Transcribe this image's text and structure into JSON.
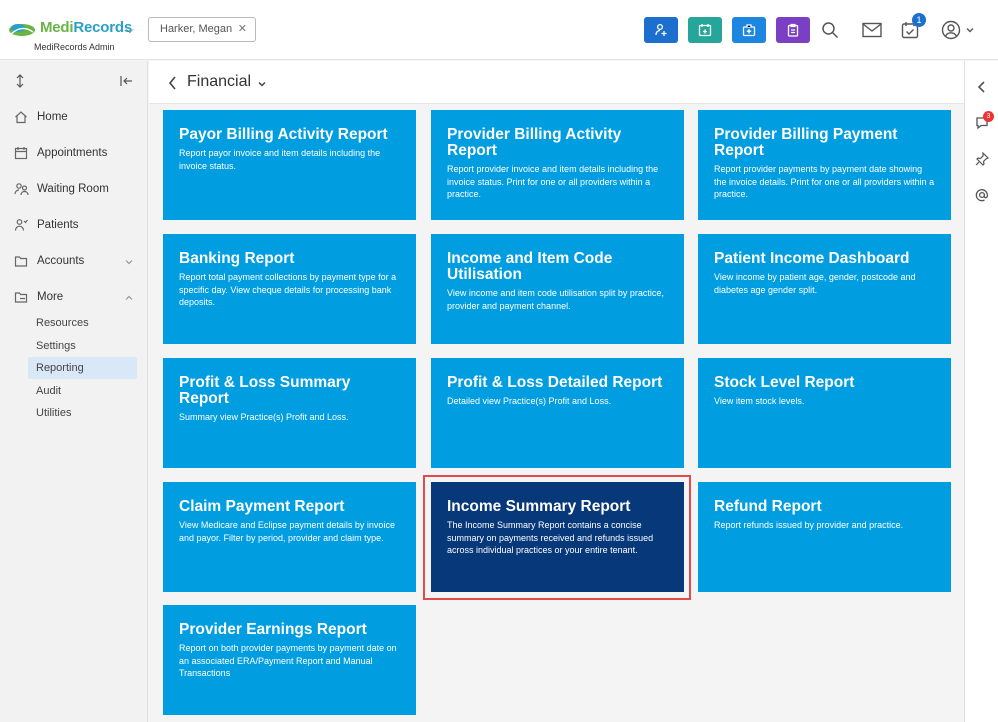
{
  "app": {
    "brand_part1": "Medi",
    "brand_part2": "Records",
    "subtitle": "MediRecords Admin",
    "accent": "#009ee0",
    "selected_card_color": "#07387a"
  },
  "header": {
    "patient_name": "Harker, Megan",
    "task_badge_count": "1",
    "action_buttons": [
      {
        "icon": "add-user-icon",
        "color": "#1d6fcf"
      },
      {
        "icon": "calendar-add-icon",
        "color": "#26a69a"
      },
      {
        "icon": "medical-case-icon",
        "color": "#1d86e0"
      },
      {
        "icon": "clipboard-icon",
        "color": "#7b3fc4"
      }
    ]
  },
  "sidebar": {
    "items": [
      {
        "label": "Home",
        "icon": "home-icon"
      },
      {
        "label": "Appointments",
        "icon": "calendar-icon"
      },
      {
        "label": "Waiting Room",
        "icon": "people-icon"
      },
      {
        "label": "Patients",
        "icon": "patient-icon"
      },
      {
        "label": "Accounts",
        "icon": "folder-icon"
      },
      {
        "label": "More",
        "icon": "folder-open-icon"
      }
    ],
    "sub_items": [
      {
        "label": "Resources"
      },
      {
        "label": "Settings"
      },
      {
        "label": "Reporting"
      },
      {
        "label": "Audit"
      },
      {
        "label": "Utilities"
      }
    ]
  },
  "page": {
    "title": "Financial"
  },
  "cards": [
    {
      "title": "Payor Billing Activity Report",
      "desc": "Report payor invoice and item details including the invoice status."
    },
    {
      "title": "Provider Billing Activity Report",
      "desc": "Report provider invoice and item details including the invoice status. Print for one or all providers within a practice."
    },
    {
      "title": "Provider Billing Payment Report",
      "desc": "Report provider payments by payment date showing the invoice details. Print for one or all providers within a practice."
    },
    {
      "title": "Banking Report",
      "desc": "Report total payment collections by payment type for a specific day. View cheque details for processing bank deposits."
    },
    {
      "title": "Income and Item Code Utilisation",
      "desc": "View income and item code utilisation split by practice, provider and payment channel."
    },
    {
      "title": "Patient Income Dashboard",
      "desc": "View income by patient age, gender, postcode and diabetes age gender split."
    },
    {
      "title": "Profit & Loss Summary Report",
      "desc": "Summary view Practice(s) Profit and Loss."
    },
    {
      "title": "Profit & Loss Detailed Report",
      "desc": "Detailed view Practice(s) Profit and Loss."
    },
    {
      "title": "Stock Level Report",
      "desc": "View item stock levels."
    },
    {
      "title": "Claim Payment Report",
      "desc": "View Medicare and Eclipse payment details by invoice and payor. Filter by period, provider and claim type."
    },
    {
      "title": "Income Summary Report",
      "desc": "The Income Summary Report contains a concise summary on payments received and refunds issued across individual practices or your entire tenant."
    },
    {
      "title": "Refund Report",
      "desc": "Report refunds issued by provider and practice."
    },
    {
      "title": "Provider Earnings Report",
      "desc": "Report on both provider payments by payment date on an associated ERA/Payment Report and Manual Transactions"
    }
  ],
  "rail": {
    "notification_badge": "3"
  }
}
